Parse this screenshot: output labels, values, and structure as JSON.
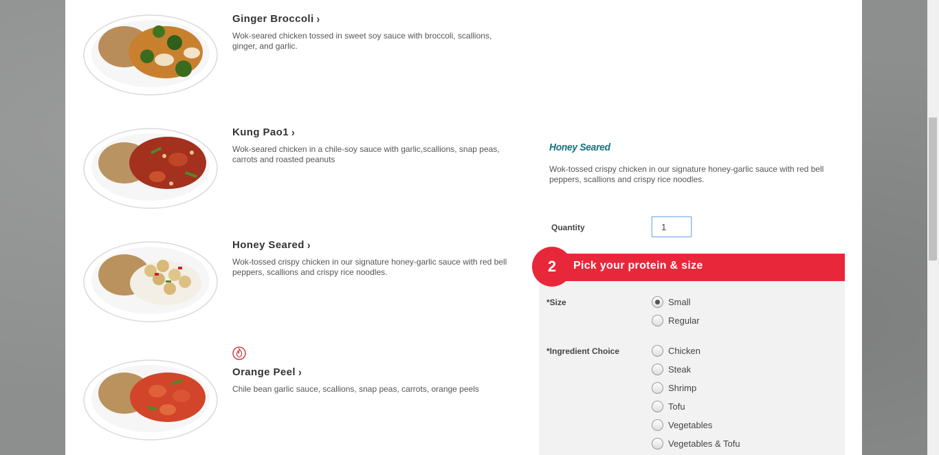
{
  "menu": {
    "items": [
      {
        "title": "Ginger Broccoli",
        "description": "Wok-seared chicken tossed in sweet soy sauce with broccoli, scallions, ginger, and garlic."
      },
      {
        "title": "Kung Pao1",
        "description": "Wok-seared chicken in a chile-soy sauce with garlic,scallions, snap peas, carrots and roasted peanuts"
      },
      {
        "title": "Honey Seared",
        "description": "Wok-tossed crispy chicken in our signature honey-garlic sauce with red bell peppers, scallions and crispy rice noodles."
      },
      {
        "title": "Orange Peel",
        "description": "Chile bean garlic sauce, scallions, snap peas, carrots, orange peels",
        "icon": "spicy-flame-icon"
      }
    ]
  },
  "detail": {
    "title": "Honey Seared",
    "description": "Wok-tossed crispy chicken in our signature honey-garlic sauce with red bell peppers, scallions and crispy rice noodles.",
    "quantity_label": "Quantity",
    "quantity_value": "1"
  },
  "step": {
    "number": "2",
    "label": "Pick your protein & size"
  },
  "options": {
    "size": {
      "label": "*Size",
      "choices": [
        "Small",
        "Regular"
      ],
      "selected": "Small"
    },
    "ingredient": {
      "label": "*Ingredient Choice",
      "choices": [
        "Chicken",
        "Steak",
        "Shrimp",
        "Tofu",
        "Vegetables",
        "Vegetables & Tofu"
      ],
      "selected": null
    }
  },
  "colors": {
    "accent_red": "#e8273b",
    "detail_title_teal": "#17717f"
  }
}
